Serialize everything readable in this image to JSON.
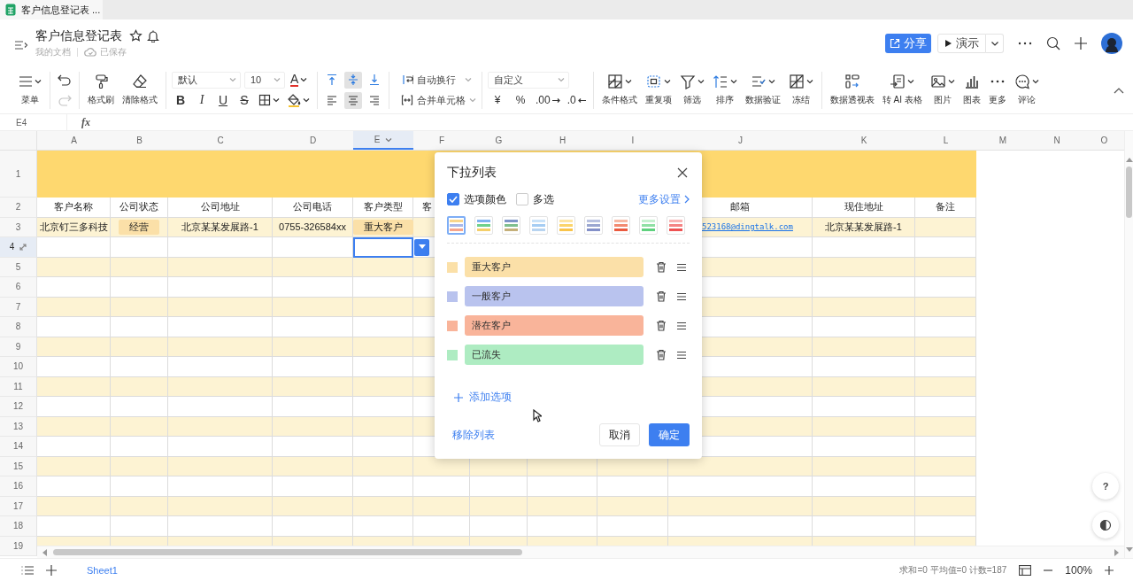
{
  "browser_tab": {
    "title": "客户信息登记表 ..."
  },
  "header": {
    "title": "客户信息登记表",
    "location": "我的文档",
    "save_status": "已保存",
    "share_button": "分享",
    "present_button": "演示"
  },
  "toolbar": [
    {
      "kind": "menu",
      "label": "菜单"
    },
    {
      "kind": "history",
      "undo": {
        "disabled": false
      },
      "redo": {
        "disabled": true
      }
    },
    {
      "kind": "tools",
      "items": [
        {
          "label": "格式刷",
          "menu": false
        },
        {
          "label": "清除格式",
          "menu": false
        }
      ]
    },
    {
      "kind": "font",
      "family": "默认",
      "size": "10",
      "color_glyph": "A",
      "styles": [
        "B",
        "I",
        "U",
        "S"
      ]
    },
    {
      "kind": "align",
      "buttons": [
        {
          "selected": false
        },
        {
          "selected": true
        },
        {
          "selected": false
        },
        {
          "selected": false
        },
        {
          "selected": true
        },
        {
          "selected": false
        }
      ]
    },
    {
      "kind": "wrap",
      "items": [
        "自动换行",
        "合并单元格"
      ]
    },
    {
      "kind": "number",
      "format": "自定义",
      "symbols": [
        "¥",
        "%",
        ".00",
        ".0"
      ]
    },
    {
      "kind": "tools",
      "items": [
        {
          "label": "条件格式",
          "menu": true
        },
        {
          "label": "重复项",
          "menu": true
        },
        {
          "label": "筛选",
          "menu": true
        },
        {
          "label": "排序",
          "menu": true
        },
        {
          "label": "数据验证",
          "menu": true
        },
        {
          "label": "冻结",
          "menu": true
        }
      ]
    },
    {
      "kind": "tools",
      "items": [
        {
          "label": "数据透视表",
          "menu": false
        },
        {
          "label": "转 AI 表格",
          "menu": true
        },
        {
          "label": "图片",
          "menu": true
        },
        {
          "label": "图表",
          "menu": false
        },
        {
          "label": "更多",
          "menu": false
        },
        {
          "label": "评论",
          "menu": true
        }
      ]
    }
  ],
  "formula_bar": {
    "name_box": "E4",
    "fx": "fx"
  },
  "sheet": {
    "columns": [
      {
        "label": "A",
        "selected": false
      },
      {
        "label": "B",
        "selected": false
      },
      {
        "label": "C",
        "selected": false
      },
      {
        "label": "D",
        "selected": false
      },
      {
        "label": "E",
        "selected": true
      },
      {
        "label": "F",
        "selected": false
      },
      {
        "label": "G",
        "selected": false
      },
      {
        "label": "H",
        "selected": false
      },
      {
        "label": "I",
        "selected": false
      },
      {
        "label": "J",
        "selected": false
      },
      {
        "label": "K",
        "selected": false
      },
      {
        "label": "L",
        "selected": false
      },
      {
        "label": "M",
        "selected": false
      },
      {
        "label": "N",
        "selected": false
      },
      {
        "label": "O",
        "selected": false
      }
    ],
    "rows": [
      {
        "label": "1",
        "kind": "title",
        "selected": false
      },
      {
        "label": "2",
        "kind": "header",
        "selected": false,
        "cells": [
          {
            "text": "客户名称"
          },
          {
            "text": "公司状态"
          },
          {
            "text": "公司地址"
          },
          {
            "text": "公司电话"
          },
          {
            "text": "客户类型"
          },
          {
            "text": "客",
            "covered": true
          },
          null,
          null,
          null,
          {
            "text": "邮箱"
          },
          {
            "text": "现住地址"
          },
          {
            "text": "备注"
          }
        ]
      },
      {
        "label": "3",
        "kind": "data",
        "selected": false,
        "shaded": true,
        "cells": [
          {
            "kind": "text",
            "text": "北京钉三多科技"
          },
          {
            "kind": "tag",
            "text": "经营"
          },
          {
            "kind": "text",
            "text": "北京某某发展路-1"
          },
          {
            "kind": "text",
            "text": "0755-326584xx"
          },
          {
            "kind": "tag",
            "text": "重大客户"
          },
          null,
          null,
          null,
          null,
          {
            "kind": "link",
            "text": "523168@dingtalk.com",
            "covered": true
          },
          {
            "kind": "text",
            "text": "北京某某发展路-1"
          },
          null
        ]
      },
      {
        "label": "4",
        "kind": "data",
        "selected": true,
        "shaded": false,
        "cells": [
          null,
          null,
          null,
          null,
          {
            "kind": "dropdown",
            "active": true
          }
        ]
      },
      {
        "label": "5",
        "kind": "data",
        "selected": false,
        "shaded": true
      },
      {
        "label": "6",
        "kind": "data",
        "selected": false,
        "shaded": false
      },
      {
        "label": "7",
        "kind": "data",
        "selected": false,
        "shaded": true
      },
      {
        "label": "8",
        "kind": "data",
        "selected": false,
        "shaded": false
      },
      {
        "label": "9",
        "kind": "data",
        "selected": false,
        "shaded": true
      },
      {
        "label": "10",
        "kind": "data",
        "selected": false,
        "shaded": false
      },
      {
        "label": "11",
        "kind": "data",
        "selected": false,
        "shaded": true
      },
      {
        "label": "12",
        "kind": "data",
        "selected": false,
        "shaded": false
      },
      {
        "label": "13",
        "kind": "data",
        "selected": false,
        "shaded": true
      },
      {
        "label": "14",
        "kind": "data",
        "selected": false,
        "shaded": false
      },
      {
        "label": "15",
        "kind": "data",
        "selected": false,
        "shaded": true
      },
      {
        "label": "16",
        "kind": "data",
        "selected": false,
        "shaded": false
      },
      {
        "label": "17",
        "kind": "data",
        "selected": false,
        "shaded": true
      },
      {
        "label": "18",
        "kind": "data",
        "selected": false,
        "shaded": false
      },
      {
        "label": "19",
        "kind": "data",
        "selected": false,
        "shaded": true
      }
    ]
  },
  "dialog": {
    "title": "下拉列表",
    "options_color": {
      "label": "选项颜色",
      "checked": true
    },
    "multi_select": {
      "label": "多选",
      "checked": false
    },
    "more_settings": "更多设置",
    "palettes": [
      {
        "selected": true,
        "bars": [
          {
            "color": "#f9d68b"
          },
          {
            "color": "#a9b8e8"
          },
          {
            "color": "#f6a58d"
          }
        ]
      },
      {
        "selected": false,
        "bars": [
          {
            "color": "#7fb2f0"
          },
          {
            "color": "#6fd08b"
          },
          {
            "color": "#f4cf6a"
          }
        ]
      },
      {
        "selected": false,
        "bars": [
          {
            "color": "#7e95c8"
          },
          {
            "color": "#7fbf8e"
          },
          {
            "color": "#c5b07a"
          }
        ]
      },
      {
        "selected": false,
        "bars": [
          {
            "color": "#c9e2f8"
          },
          {
            "color": "#a6cdf3"
          },
          {
            "color": "#b8d4f0"
          }
        ]
      },
      {
        "selected": false,
        "bars": [
          {
            "color": "#fde5a3"
          },
          {
            "color": "#fbd46a"
          },
          {
            "color": "#f9c44a"
          }
        ]
      },
      {
        "selected": false,
        "bars": [
          {
            "color": "#b8c1e0"
          },
          {
            "color": "#9aa6d0"
          },
          {
            "color": "#8390c8"
          }
        ]
      },
      {
        "selected": false,
        "bars": [
          {
            "color": "#f7b9a4"
          },
          {
            "color": "#f28a70"
          },
          {
            "color": "#ea5a3f"
          }
        ]
      },
      {
        "selected": false,
        "bars": [
          {
            "color": "#c5f0cf"
          },
          {
            "color": "#8fe0a4"
          },
          {
            "color": "#5fd17e"
          }
        ]
      },
      {
        "selected": false,
        "bars": [
          {
            "color": "#f9b4b4"
          },
          {
            "color": "#f48484"
          },
          {
            "color": "#ee5252"
          }
        ]
      }
    ],
    "options": [
      {
        "text": "重大客户",
        "color": "#fbe0a8"
      },
      {
        "text": "一般客户",
        "color": "#b9c3ee"
      },
      {
        "text": "潜在客户",
        "color": "#f9b49a"
      },
      {
        "text": "已流失",
        "color": "#aeecc2"
      }
    ],
    "add_option": "添加选项",
    "remove_list": "移除列表",
    "cancel": "取消",
    "confirm": "确定"
  },
  "floating": {
    "help": "?"
  },
  "status_bar": {
    "sheet_tabs": [
      {
        "label": "Sheet1",
        "selected": true
      }
    ],
    "summary": "求和=0 平均值=0 计数=187",
    "zoom": "100%"
  }
}
